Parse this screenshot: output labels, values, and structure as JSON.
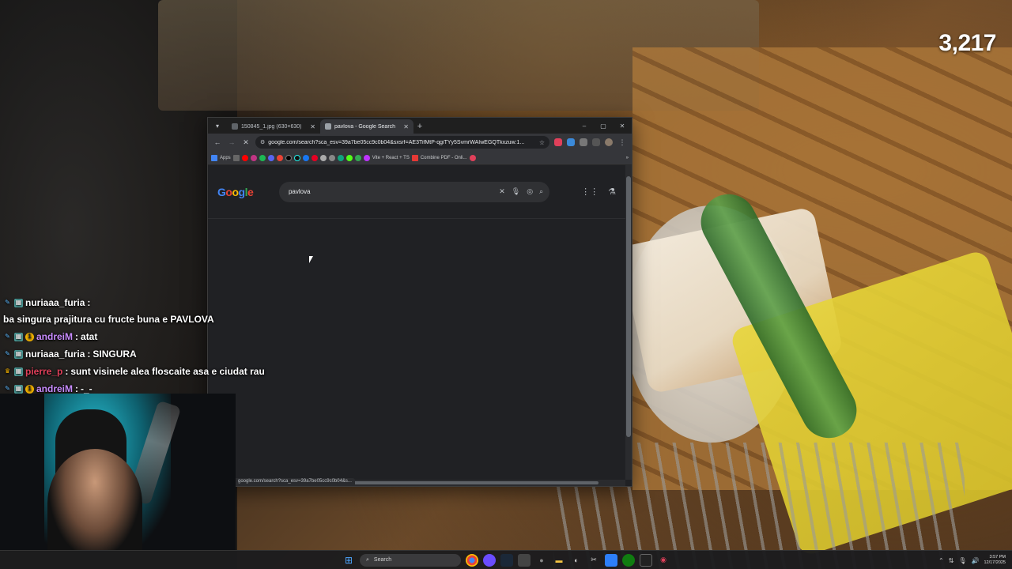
{
  "stream": {
    "viewer_count": "3,217"
  },
  "browser": {
    "tabs": [
      {
        "title": "150845_1.jpg (630×630)",
        "favicon_color": "#5f6368",
        "active": false
      },
      {
        "title": "pavlova - Google Search",
        "favicon_color": "#9aa0a6",
        "active": true
      }
    ],
    "new_tab_symbol": "+",
    "window_controls": {
      "minimize": "–",
      "maximize": "▢",
      "close": "✕"
    },
    "address_url": "google.com/search?sca_esv=39a7be05cc9c0b04&sxsrf=AE3TifMtP-qgiTYy5SvmrWAIwEGQTkxzuw:1...",
    "bookmarks": {
      "apps_label": "Apps",
      "vite_label": "Vite + React + TS",
      "combine_label": "Combine PDF - Onli..."
    },
    "status_url": "google.com/search?sca_esv=39a7be05cc9c0b04&s..."
  },
  "google": {
    "logo_letters": [
      {
        "char": "G",
        "color": "#4285f4"
      },
      {
        "char": "o",
        "color": "#ea4335"
      },
      {
        "char": "o",
        "color": "#fbbc05"
      },
      {
        "char": "g",
        "color": "#4285f4"
      },
      {
        "char": "l",
        "color": "#34a853"
      },
      {
        "char": "e",
        "color": "#ea4335"
      }
    ],
    "query": "pavlova"
  },
  "chat": {
    "messages": [
      {
        "user": "nuriaaa_furia",
        "user_color": "#ffffff",
        "text": "ba singura prajitura cu fructe buna e PAVLOVA",
        "badges": [
          "tool",
          "sub"
        ]
      },
      {
        "user": "andreiM",
        "user_color": "#c98cff",
        "text": "atat",
        "badges": [
          "tool",
          "sub",
          "gold"
        ]
      },
      {
        "user": "nuriaaa_furia",
        "user_color": "#ffffff",
        "text": "SINGURA",
        "badges": [
          "tool",
          "sub"
        ]
      },
      {
        "user": "pierre_p",
        "user_color": "#e0405a",
        "text": "sunt visinele alea floscaite asa e ciudat rau",
        "badges": [
          "crown",
          "sub"
        ]
      },
      {
        "user": "andreiM",
        "user_color": "#c98cff",
        "text": "-_-",
        "badges": [
          "tool",
          "sub",
          "gold"
        ]
      }
    ]
  },
  "taskbar": {
    "search_label": "Search",
    "time": "3:57 PM",
    "date": "12/17/2025"
  }
}
